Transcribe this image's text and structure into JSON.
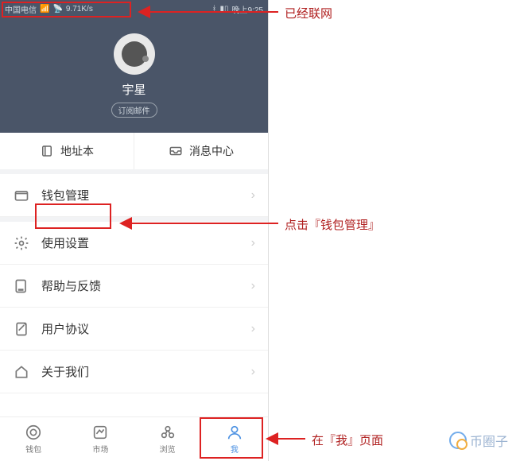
{
  "statusbar": {
    "carrier": "中国电信",
    "speed": "9.71K/s",
    "time": "晚上9:25"
  },
  "header": {
    "username": "宇星",
    "subscribe": "订阅邮件"
  },
  "quick": {
    "address_book": "地址本",
    "message_center": "消息中心"
  },
  "rows": {
    "wallet_manage": "钱包管理",
    "settings": "使用设置",
    "help": "帮助与反馈",
    "agreement": "用户协议",
    "about": "关于我们"
  },
  "tabs": {
    "wallet": "钱包",
    "market": "市场",
    "browse": "浏览",
    "me": "我"
  },
  "annotations": {
    "connected": "已经联网",
    "click_wallet": "点击『钱包管理』",
    "me_page": "在『我』页面"
  },
  "watermark": "币圈子"
}
